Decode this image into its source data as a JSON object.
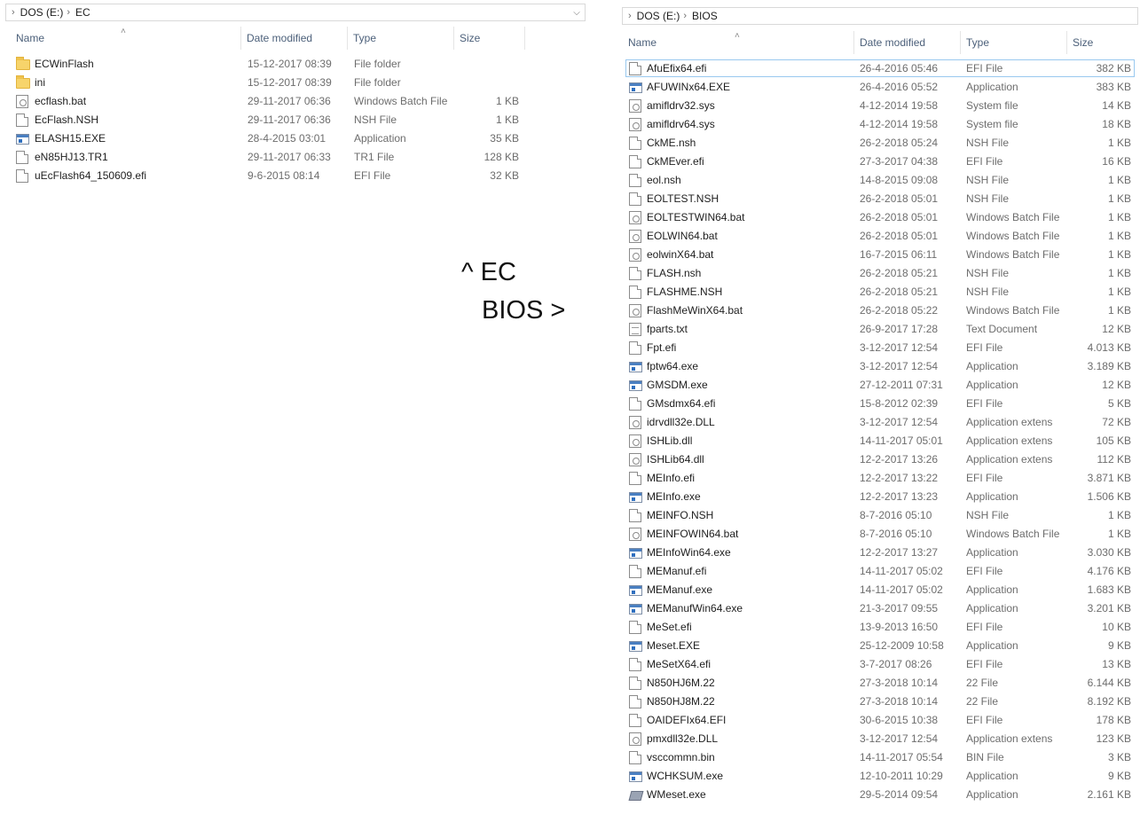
{
  "left": {
    "breadcrumb": [
      "DOS (E:)",
      "EC"
    ],
    "headers": {
      "name": "Name",
      "date": "Date modified",
      "type": "Type",
      "size": "Size"
    },
    "files": [
      {
        "name": "ECWinFlash",
        "date": "15-12-2017 08:39",
        "type": "File folder",
        "size": "",
        "icon": "folder"
      },
      {
        "name": "ini",
        "date": "15-12-2017 08:39",
        "type": "File folder",
        "size": "",
        "icon": "folder"
      },
      {
        "name": "ecflash.bat",
        "date": "29-11-2017 06:36",
        "type": "Windows Batch File",
        "size": "1 KB",
        "icon": "gear"
      },
      {
        "name": "EcFlash.NSH",
        "date": "29-11-2017 06:36",
        "type": "NSH File",
        "size": "1 KB",
        "icon": "doc"
      },
      {
        "name": "ELASH15.EXE",
        "date": "28-4-2015 03:01",
        "type": "Application",
        "size": "35 KB",
        "icon": "app"
      },
      {
        "name": "eN85HJ13.TR1",
        "date": "29-11-2017 06:33",
        "type": "TR1 File",
        "size": "128 KB",
        "icon": "doc"
      },
      {
        "name": "uEcFlash64_150609.efi",
        "date": "9-6-2015 08:14",
        "type": "EFI File",
        "size": "32 KB",
        "icon": "doc"
      }
    ]
  },
  "right": {
    "breadcrumb": [
      "DOS (E:)",
      "BIOS"
    ],
    "headers": {
      "name": "Name",
      "date": "Date modified",
      "type": "Type",
      "size": "Size"
    },
    "files": [
      {
        "name": "AfuEfix64.efi",
        "date": "26-4-2016 05:46",
        "type": "EFI File",
        "size": "382 KB",
        "icon": "doc"
      },
      {
        "name": "AFUWINx64.EXE",
        "date": "26-4-2016 05:52",
        "type": "Application",
        "size": "383 KB",
        "icon": "app"
      },
      {
        "name": "amifldrv32.sys",
        "date": "4-12-2014 19:58",
        "type": "System file",
        "size": "14 KB",
        "icon": "gear"
      },
      {
        "name": "amifldrv64.sys",
        "date": "4-12-2014 19:58",
        "type": "System file",
        "size": "18 KB",
        "icon": "gear"
      },
      {
        "name": "CkME.nsh",
        "date": "26-2-2018 05:24",
        "type": "NSH File",
        "size": "1 KB",
        "icon": "doc"
      },
      {
        "name": "CkMEver.efi",
        "date": "27-3-2017 04:38",
        "type": "EFI File",
        "size": "16 KB",
        "icon": "doc"
      },
      {
        "name": "eol.nsh",
        "date": "14-8-2015 09:08",
        "type": "NSH File",
        "size": "1 KB",
        "icon": "doc"
      },
      {
        "name": "EOLTEST.NSH",
        "date": "26-2-2018 05:01",
        "type": "NSH File",
        "size": "1 KB",
        "icon": "doc"
      },
      {
        "name": "EOLTESTWIN64.bat",
        "date": "26-2-2018 05:01",
        "type": "Windows Batch File",
        "size": "1 KB",
        "icon": "gear"
      },
      {
        "name": "EOLWIN64.bat",
        "date": "26-2-2018 05:01",
        "type": "Windows Batch File",
        "size": "1 KB",
        "icon": "gear"
      },
      {
        "name": "eolwinX64.bat",
        "date": "16-7-2015 06:11",
        "type": "Windows Batch File",
        "size": "1 KB",
        "icon": "gear"
      },
      {
        "name": "FLASH.nsh",
        "date": "26-2-2018 05:21",
        "type": "NSH File",
        "size": "1 KB",
        "icon": "doc"
      },
      {
        "name": "FLASHME.NSH",
        "date": "26-2-2018 05:21",
        "type": "NSH File",
        "size": "1 KB",
        "icon": "doc"
      },
      {
        "name": "FlashMeWinX64.bat",
        "date": "26-2-2018 05:22",
        "type": "Windows Batch File",
        "size": "1 KB",
        "icon": "gear"
      },
      {
        "name": "fparts.txt",
        "date": "26-9-2017 17:28",
        "type": "Text Document",
        "size": "12 KB",
        "icon": "txt"
      },
      {
        "name": "Fpt.efi",
        "date": "3-12-2017 12:54",
        "type": "EFI File",
        "size": "4.013 KB",
        "icon": "doc"
      },
      {
        "name": "fptw64.exe",
        "date": "3-12-2017 12:54",
        "type": "Application",
        "size": "3.189 KB",
        "icon": "app"
      },
      {
        "name": "GMSDM.exe",
        "date": "27-12-2011 07:31",
        "type": "Application",
        "size": "12 KB",
        "icon": "app"
      },
      {
        "name": "GMsdmx64.efi",
        "date": "15-8-2012 02:39",
        "type": "EFI File",
        "size": "5 KB",
        "icon": "doc"
      },
      {
        "name": "idrvdll32e.DLL",
        "date": "3-12-2017 12:54",
        "type": "Application extens",
        "size": "72 KB",
        "icon": "gear"
      },
      {
        "name": "ISHLib.dll",
        "date": "14-11-2017 05:01",
        "type": "Application extens",
        "size": "105 KB",
        "icon": "gear"
      },
      {
        "name": "ISHLib64.dll",
        "date": "12-2-2017 13:26",
        "type": "Application extens",
        "size": "112 KB",
        "icon": "gear"
      },
      {
        "name": "MEInfo.efi",
        "date": "12-2-2017 13:22",
        "type": "EFI File",
        "size": "3.871 KB",
        "icon": "doc"
      },
      {
        "name": "MEInfo.exe",
        "date": "12-2-2017 13:23",
        "type": "Application",
        "size": "1.506 KB",
        "icon": "app"
      },
      {
        "name": "MEINFO.NSH",
        "date": "8-7-2016 05:10",
        "type": "NSH File",
        "size": "1 KB",
        "icon": "doc"
      },
      {
        "name": "MEINFOWIN64.bat",
        "date": "8-7-2016 05:10",
        "type": "Windows Batch File",
        "size": "1 KB",
        "icon": "gear"
      },
      {
        "name": "MEInfoWin64.exe",
        "date": "12-2-2017 13:27",
        "type": "Application",
        "size": "3.030 KB",
        "icon": "app"
      },
      {
        "name": "MEManuf.efi",
        "date": "14-11-2017 05:02",
        "type": "EFI File",
        "size": "4.176 KB",
        "icon": "doc"
      },
      {
        "name": "MEManuf.exe",
        "date": "14-11-2017 05:02",
        "type": "Application",
        "size": "1.683 KB",
        "icon": "app"
      },
      {
        "name": "MEManufWin64.exe",
        "date": "21-3-2017 09:55",
        "type": "Application",
        "size": "3.201 KB",
        "icon": "app"
      },
      {
        "name": "MeSet.efi",
        "date": "13-9-2013 16:50",
        "type": "EFI File",
        "size": "10 KB",
        "icon": "doc"
      },
      {
        "name": "Meset.EXE",
        "date": "25-12-2009 10:58",
        "type": "Application",
        "size": "9 KB",
        "icon": "app"
      },
      {
        "name": "MeSetX64.efi",
        "date": "3-7-2017 08:26",
        "type": "EFI File",
        "size": "13 KB",
        "icon": "doc"
      },
      {
        "name": "N850HJ6M.22",
        "date": "27-3-2018 10:14",
        "type": "22 File",
        "size": "6.144 KB",
        "icon": "doc"
      },
      {
        "name": "N850HJ8M.22",
        "date": "27-3-2018 10:14",
        "type": "22 File",
        "size": "8.192 KB",
        "icon": "doc"
      },
      {
        "name": "OAIDEFIx64.EFI",
        "date": "30-6-2015 10:38",
        "type": "EFI File",
        "size": "178 KB",
        "icon": "doc"
      },
      {
        "name": "pmxdll32e.DLL",
        "date": "3-12-2017 12:54",
        "type": "Application extens",
        "size": "123 KB",
        "icon": "gear"
      },
      {
        "name": "vsccommn.bin",
        "date": "14-11-2017 05:54",
        "type": "BIN File",
        "size": "3 KB",
        "icon": "doc"
      },
      {
        "name": "WCHKSUM.exe",
        "date": "12-10-2011 10:29",
        "type": "Application",
        "size": "9 KB",
        "icon": "app"
      },
      {
        "name": "WMeset.exe",
        "date": "29-5-2014 09:54",
        "type": "Application",
        "size": "2.161 KB",
        "icon": "wme"
      }
    ]
  },
  "annotation": {
    "line1": "^ EC",
    "line2": "BIOS >"
  }
}
